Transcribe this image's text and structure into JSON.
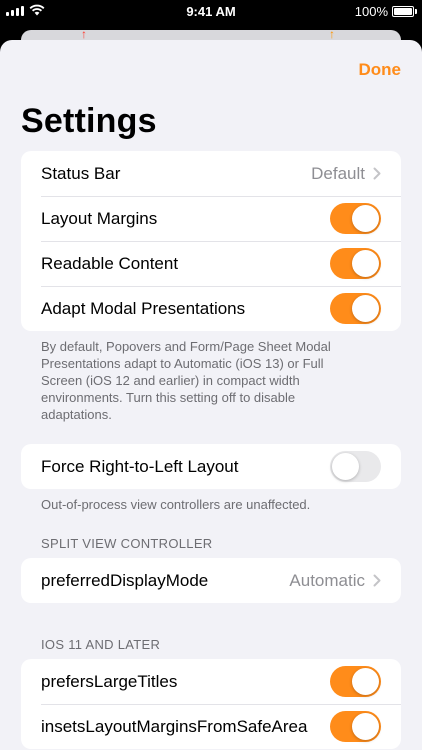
{
  "status_bar": {
    "time": "9:41 AM",
    "battery": "100%"
  },
  "nav": {
    "done_label": "Done",
    "title": "Settings"
  },
  "colors": {
    "accent": "#ff8c1a",
    "group_bg": "#ffffff",
    "background": "#f2f2f7",
    "secondary_text": "#8e8e93",
    "footer_text": "#6d6d72"
  },
  "general": {
    "rows": [
      {
        "label": "Status Bar",
        "type": "disclosure",
        "value": "Default",
        "icon": "chevron-right-icon"
      },
      {
        "label": "Layout Margins",
        "type": "toggle",
        "on": true
      },
      {
        "label": "Readable Content",
        "type": "toggle",
        "on": true
      },
      {
        "label": "Adapt Modal Presentations",
        "type": "toggle",
        "on": true
      }
    ],
    "footer": "By default, Popovers and Form/Page Sheet Modal Presentations adapt to Automatic (iOS 13) or Full Screen (iOS 12 and earlier) in compact width environments. Turn this setting off to disable adaptations."
  },
  "rtl": {
    "rows": [
      {
        "label": "Force Right-to-Left Layout",
        "type": "toggle",
        "on": false
      }
    ],
    "footer": "Out-of-process view controllers are unaffected."
  },
  "split_view": {
    "header": "SPLIT VIEW CONTROLLER",
    "rows": [
      {
        "label": "preferredDisplayMode",
        "type": "disclosure",
        "value": "Automatic",
        "icon": "chevron-right-icon"
      }
    ]
  },
  "ios11": {
    "header": "IOS 11 AND LATER",
    "rows": [
      {
        "label": "prefersLargeTitles",
        "type": "toggle",
        "on": true
      },
      {
        "label": "insetsLayoutMarginsFromSafeArea",
        "type": "toggle",
        "on": true
      }
    ]
  }
}
